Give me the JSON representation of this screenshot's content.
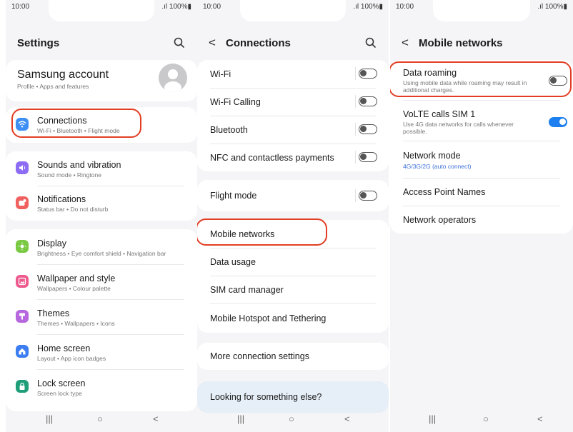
{
  "status": {
    "time": "10:00",
    "battery": ".ıl 100%▮"
  },
  "screen1": {
    "title": "Settings",
    "account": {
      "title": "Samsung account",
      "subtitle": "Profile • Apps and features"
    },
    "items": [
      {
        "title": "Connections",
        "subtitle": "Wi-Fi • Bluetooth • Flight mode",
        "icon": "wifi-icon",
        "color": "#3d8ff5"
      },
      {
        "title": "Sounds and vibration",
        "subtitle": "Sound mode • Ringtone",
        "icon": "sound-icon",
        "color": "#8b6cf2"
      },
      {
        "title": "Notifications",
        "subtitle": "Status bar • Do not disturb",
        "icon": "notification-icon",
        "color": "#f0605f"
      },
      {
        "title": "Display",
        "subtitle": "Brightness • Eye comfort shield • Navigation bar",
        "icon": "display-icon",
        "color": "#7ac943"
      },
      {
        "title": "Wallpaper and style",
        "subtitle": "Wallpapers • Colour palette",
        "icon": "wallpaper-icon",
        "color": "#ee5a8d"
      },
      {
        "title": "Themes",
        "subtitle": "Themes • Wallpapers • Icons",
        "icon": "themes-icon",
        "color": "#b668de"
      },
      {
        "title": "Home screen",
        "subtitle": "Layout • App icon badges",
        "icon": "home-icon",
        "color": "#3c7ef2"
      },
      {
        "title": "Lock screen",
        "subtitle": "Screen lock type",
        "icon": "lock-icon",
        "color": "#1f9e7a"
      }
    ]
  },
  "screen2": {
    "title": "Connections",
    "items": [
      {
        "label": "Wi-Fi",
        "toggle": false
      },
      {
        "label": "Wi-Fi Calling",
        "toggle": false
      },
      {
        "label": "Bluetooth",
        "toggle": false
      },
      {
        "label": "NFC and contactless payments",
        "toggle": false
      },
      {
        "label": "Flight mode",
        "toggle": false
      },
      {
        "label": "Mobile networks"
      },
      {
        "label": "Data usage"
      },
      {
        "label": "SIM card manager"
      },
      {
        "label": "Mobile Hotspot and Tethering"
      },
      {
        "label": "More connection settings"
      },
      {
        "label": "Looking for something else?"
      }
    ]
  },
  "screen3": {
    "title": "Mobile networks",
    "items": [
      {
        "title": "Data roaming",
        "subtitle": "Using mobile data while roaming may result in additional charges.",
        "toggle": false
      },
      {
        "title": "VoLTE calls SIM 1",
        "subtitle": "Use 4G data networks for calls whenever possible.",
        "toggle": true
      },
      {
        "title": "Network mode",
        "subtitle": "4G/3G/2G (auto connect)"
      },
      {
        "title": "Access Point Names"
      },
      {
        "title": "Network operators"
      }
    ]
  },
  "nav": {
    "recents": "|||",
    "home": "○",
    "back": "<"
  },
  "colors": {
    "highlight": "#e23e23",
    "toggle_on": "#1e7ff0",
    "link_blue": "#3b6fd9"
  }
}
